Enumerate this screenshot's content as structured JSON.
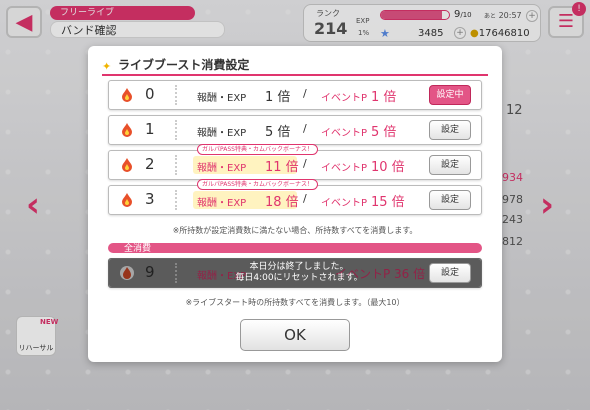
{
  "header": {
    "back_icon": "back-arrow-icon",
    "tag": "フリーライブ",
    "title": "バンド確認"
  },
  "status": {
    "rank_label": "ランク",
    "rank": "214",
    "exp_label": "EXP",
    "exp_pct": "1%",
    "lp_fraction": 0.9,
    "lp_value": "9",
    "lp_max": "/10",
    "lp_timer_label": "あと",
    "lp_timer": "20:57",
    "gems": "3485",
    "coins": "17646810"
  },
  "menu": {
    "badge": "!"
  },
  "background": {
    "right_values": [
      "12",
      "934",
      "978",
      "243",
      "812"
    ],
    "rehearsal_label": "リハーサル",
    "new_label": "NEW"
  },
  "dialog": {
    "title": "ライブブースト消費設定",
    "reward_label": "報酬・EXP",
    "event_label": "イベントP",
    "slash": "/",
    "bonus_banner": "ガルパPASS特典・カムバックボーナス！",
    "rows": [
      {
        "num": "0",
        "exp": "1 倍",
        "evt": "1 倍",
        "button": "設定中",
        "active": true
      },
      {
        "num": "1",
        "exp": "5 倍",
        "evt": "5 倍",
        "button": "設定",
        "active": false
      },
      {
        "num": "2",
        "exp": "11 倍",
        "evt": "10 倍",
        "button": "設定",
        "active": false
      },
      {
        "num": "3",
        "exp": "18 倍",
        "evt": "15 倍",
        "button": "設定",
        "active": false
      }
    ],
    "note1": "※所持数が設定消費数に満たない場合、所持数すべてを消費します。",
    "all_label": "全消費",
    "all_row": {
      "num": "9",
      "exp": "報酬・EXP",
      "evt": "イベントP 36 倍",
      "button": "設定",
      "msg_line1": "本日分は終了しました。",
      "msg_line2": "毎日4:00にリセットされます。"
    },
    "note2": "※ライブスタート時の所持数すべてを消費します。（最大10）",
    "ok": "OK"
  },
  "colors": {
    "accent": "#e0356e",
    "highlight": "#fff3c0"
  }
}
